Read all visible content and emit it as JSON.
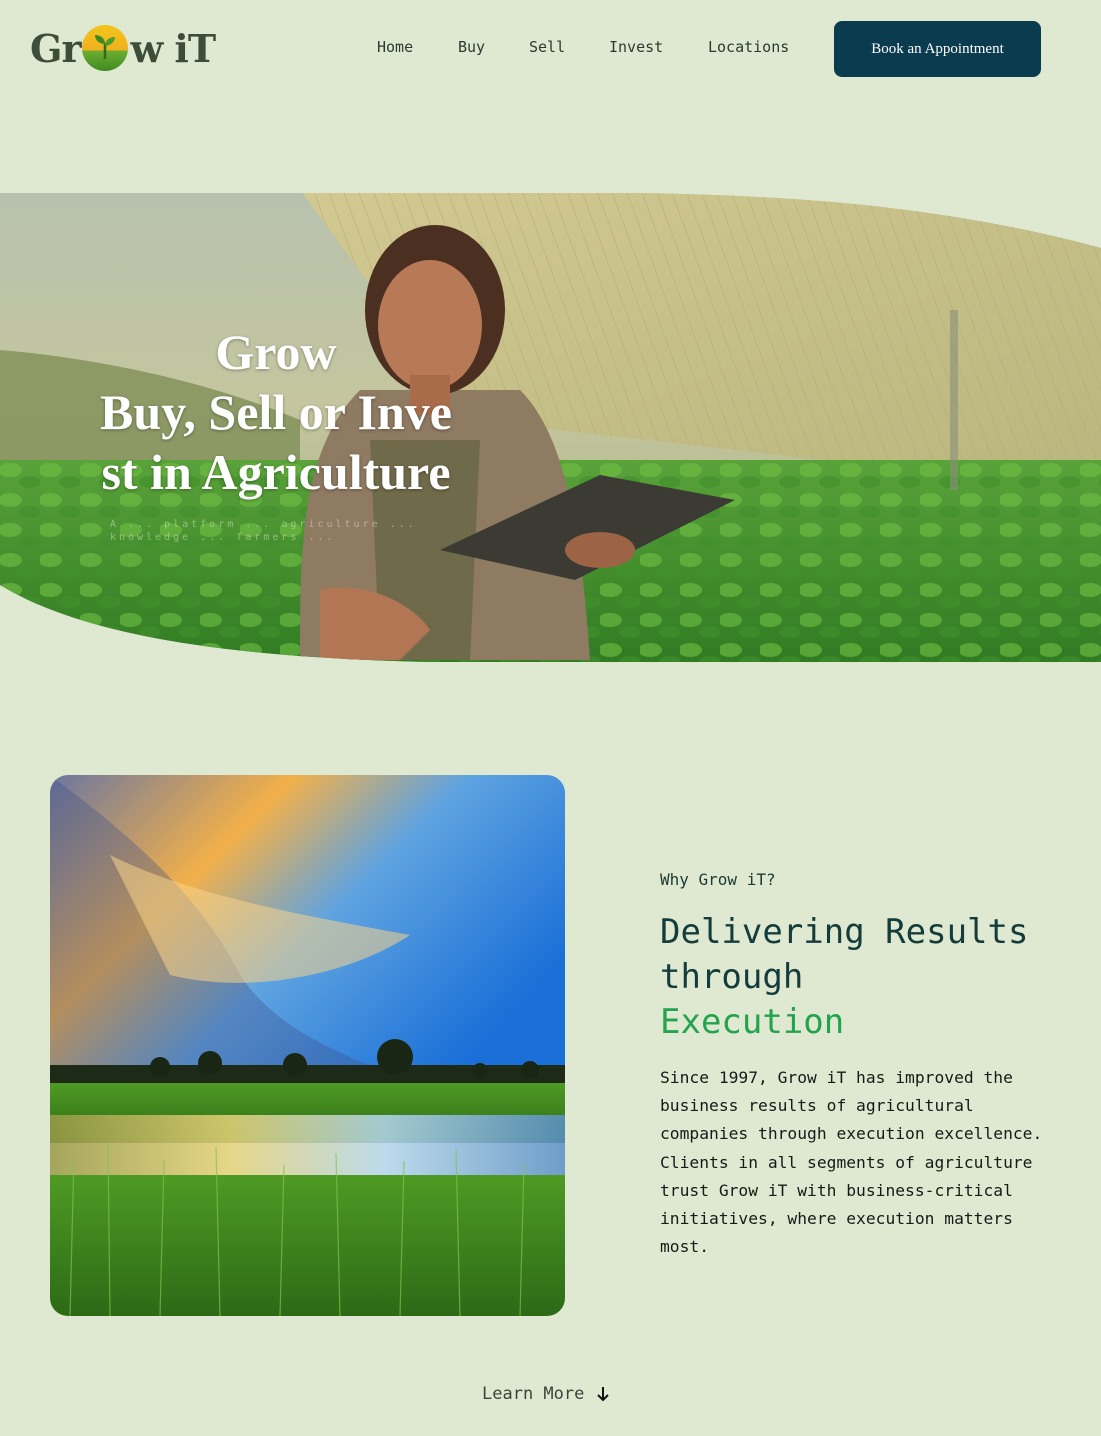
{
  "brand": {
    "logo_left": "Gr",
    "logo_right": "w iT"
  },
  "nav": {
    "items": [
      "Home",
      "Buy",
      "Sell",
      "Invest",
      "Locations"
    ],
    "cta": "Book an Appointment"
  },
  "hero": {
    "line1": "Grow",
    "line2": "Buy, Sell or Invest in Agriculture",
    "subtitle": "A ... platform ... agriculture ... knowledge ... farmers ..."
  },
  "about": {
    "eyebrow": "Why Grow iT?",
    "heading_main": "Delivering Results through",
    "heading_accent": "Execution",
    "body": "Since 1997, Grow iT has improved the business results of agricultural companies through execution excellence. Clients in all segments of agriculture trust Grow iT with business-critical initiatives, where execution matters most."
  },
  "learn_more": {
    "label": "Learn More",
    "icon": "arrow-down-icon"
  },
  "colors": {
    "background": "#dfe9d1",
    "cta": "#0b3b4f",
    "accent": "#24a34e",
    "heading": "#143c3a"
  }
}
